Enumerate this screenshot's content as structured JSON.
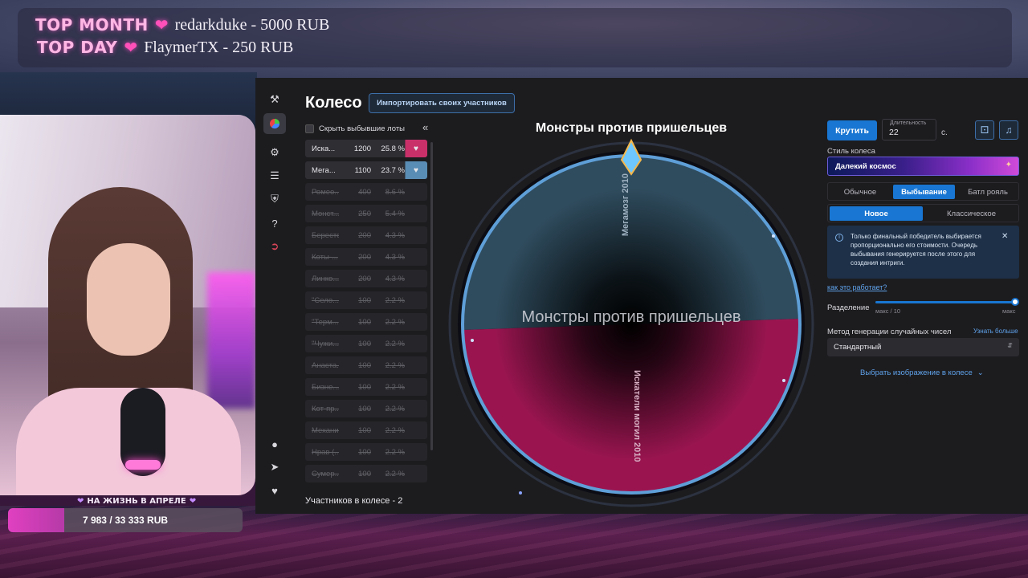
{
  "stream": {
    "top_month": {
      "label": "TOP MONTH",
      "value": "redarkduke - 5000 RUB"
    },
    "top_day": {
      "label": "TOP DAY",
      "value": "FlaymerTX - 250 RUB"
    },
    "goal": {
      "title": "НА ЖИЗНЬ В АПРЕЛЕ",
      "text": "7 983 / 33 333 RUB",
      "progress": 0.2395
    }
  },
  "app": {
    "title": "Колесо",
    "import_button": "Импортировать своих участников",
    "hide_dropped_label": "Скрыть выбывшие лоты",
    "lots": [
      {
        "name": "Иска...",
        "amount": "1200",
        "percent": "25.8 %",
        "state": "active",
        "color": "#c9306a"
      },
      {
        "name": "Мега...",
        "amount": "1100",
        "percent": "23.7 %",
        "state": "active",
        "color": "#5a8db5"
      },
      {
        "name": "Ромео...",
        "amount": "400",
        "percent": "8.6 %",
        "state": "dropped"
      },
      {
        "name": "Монст...",
        "amount": "250",
        "percent": "5.4 %",
        "state": "dropped"
      },
      {
        "name": "Бересте...",
        "amount": "200",
        "percent": "4.3 %",
        "state": "dropped"
      },
      {
        "name": "Коты-...",
        "amount": "200",
        "percent": "4.3 %",
        "state": "dropped"
      },
      {
        "name": "Линко...",
        "amount": "200",
        "percent": "4.3 %",
        "state": "dropped"
      },
      {
        "name": "\"Село...",
        "amount": "100",
        "percent": "2.2 %",
        "state": "dropped"
      },
      {
        "name": "\"Терм...",
        "amount": "100",
        "percent": "2.2 %",
        "state": "dropped"
      },
      {
        "name": "\"Чужи...",
        "amount": "100",
        "percent": "2.2 %",
        "state": "dropped"
      },
      {
        "name": "Анаста...",
        "amount": "100",
        "percent": "2.2 %",
        "state": "dropped"
      },
      {
        "name": "Бизне...",
        "amount": "100",
        "percent": "2.2 %",
        "state": "dropped"
      },
      {
        "name": "Кот-пр...",
        "amount": "100",
        "percent": "2.2 %",
        "state": "dropped"
      },
      {
        "name": "Механик...",
        "amount": "100",
        "percent": "2.2 %",
        "state": "dropped"
      },
      {
        "name": "Нрав (...",
        "amount": "100",
        "percent": "2.2 %",
        "state": "dropped"
      },
      {
        "name": "Сумер...",
        "amount": "100",
        "percent": "2.2 %",
        "state": "dropped"
      }
    ],
    "participants_text": "Участников в колесе - 2",
    "wheel": {
      "title": "Монстры против пришельцев",
      "center_label": "Монстры против пришельцев",
      "segments": [
        {
          "label": "Мегамозг 2010",
          "share": 0.5,
          "color": "#2f4c5e"
        },
        {
          "label": "Искатели могил 2010",
          "share": 0.5,
          "color": "#9a1550"
        }
      ]
    },
    "settings": {
      "spin_button": "Крутить",
      "duration_label": "Длительность",
      "duration_value": "22",
      "duration_unit": "с.",
      "style_label": "Стиль колеса",
      "style_value": "Далекий космос",
      "modes": [
        "Обычное",
        "Выбывание",
        "Батл рояль"
      ],
      "active_mode": "Выбывание",
      "submodes": [
        "Новое",
        "Классическое"
      ],
      "active_submode": "Новое",
      "info_text": "Только финальный победитель выбирается пропорционально его стоимости. Очередь выбывания генерируется после этого для создания интриги.",
      "how_link": "как это работает?",
      "split_label": "Разделение",
      "split_min": "макс / 10",
      "split_max": "макс",
      "split_value": 1.0,
      "rng_label": "Метод генерации случайных чисел",
      "rng_link": "Узнать больше",
      "rng_value": "Стандартный",
      "image_link": "Выбрать изображение в колесе"
    }
  },
  "colors": {
    "accent": "#1976d2",
    "goal_fill": "#e040c0",
    "panel_bg": "#1c1c1f"
  }
}
